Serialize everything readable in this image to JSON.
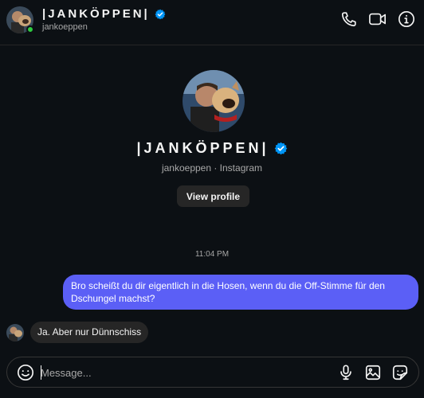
{
  "header": {
    "name": "|JANKÖPPEN|",
    "handle": "jankoeppen",
    "icons": [
      "phone-icon",
      "video-camera-icon",
      "info-icon"
    ]
  },
  "profile": {
    "name": "|JANKÖPPEN|",
    "meta": "jankoeppen · Instagram",
    "view_profile_label": "View profile"
  },
  "thread": {
    "timestamp": "11:04 PM",
    "messages": [
      {
        "direction": "outgoing",
        "text": "Bro scheißt du dir eigentlich in die Hosen, wenn du die Off-Stimme für den Dschungel machst?"
      },
      {
        "direction": "incoming",
        "text": "Ja. Aber nur Dünnschiss"
      }
    ]
  },
  "composer": {
    "placeholder": "Message...",
    "value": "",
    "icons": [
      "emoji-icon",
      "microphone-icon",
      "image-icon",
      "sticker-icon"
    ]
  },
  "colors": {
    "background": "#0c1014",
    "outgoing_bubble": "#5b5ff6",
    "incoming_bubble": "#262626",
    "verified": "#0095f6",
    "online": "#2ecc40"
  }
}
